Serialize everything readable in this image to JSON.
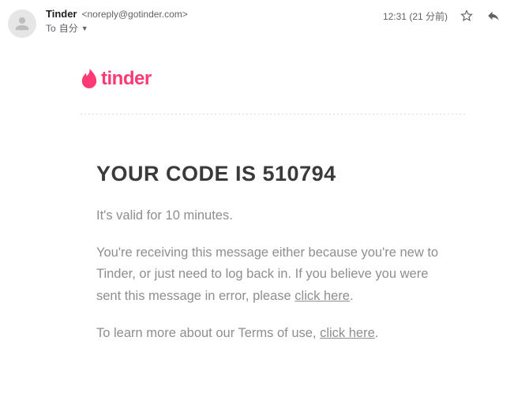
{
  "header": {
    "sender_name": "Tinder",
    "sender_email": "<noreply@gotinder.com>",
    "timestamp": "12:31 (21 分前)",
    "recipient_prefix": "To",
    "recipient": "自分"
  },
  "brand": {
    "name": "tinder"
  },
  "message": {
    "code_heading": "YOUR CODE IS 510794",
    "validity": "It's valid for 10 minutes.",
    "body_pre": "You're receiving this message either because you're new to Tinder, or just need to log back in. If you believe you were sent this message in error, please ",
    "body_link": "click here",
    "body_post": ".",
    "terms_pre": "To learn more about our Terms of use, ",
    "terms_link": "click here",
    "terms_post": "."
  }
}
